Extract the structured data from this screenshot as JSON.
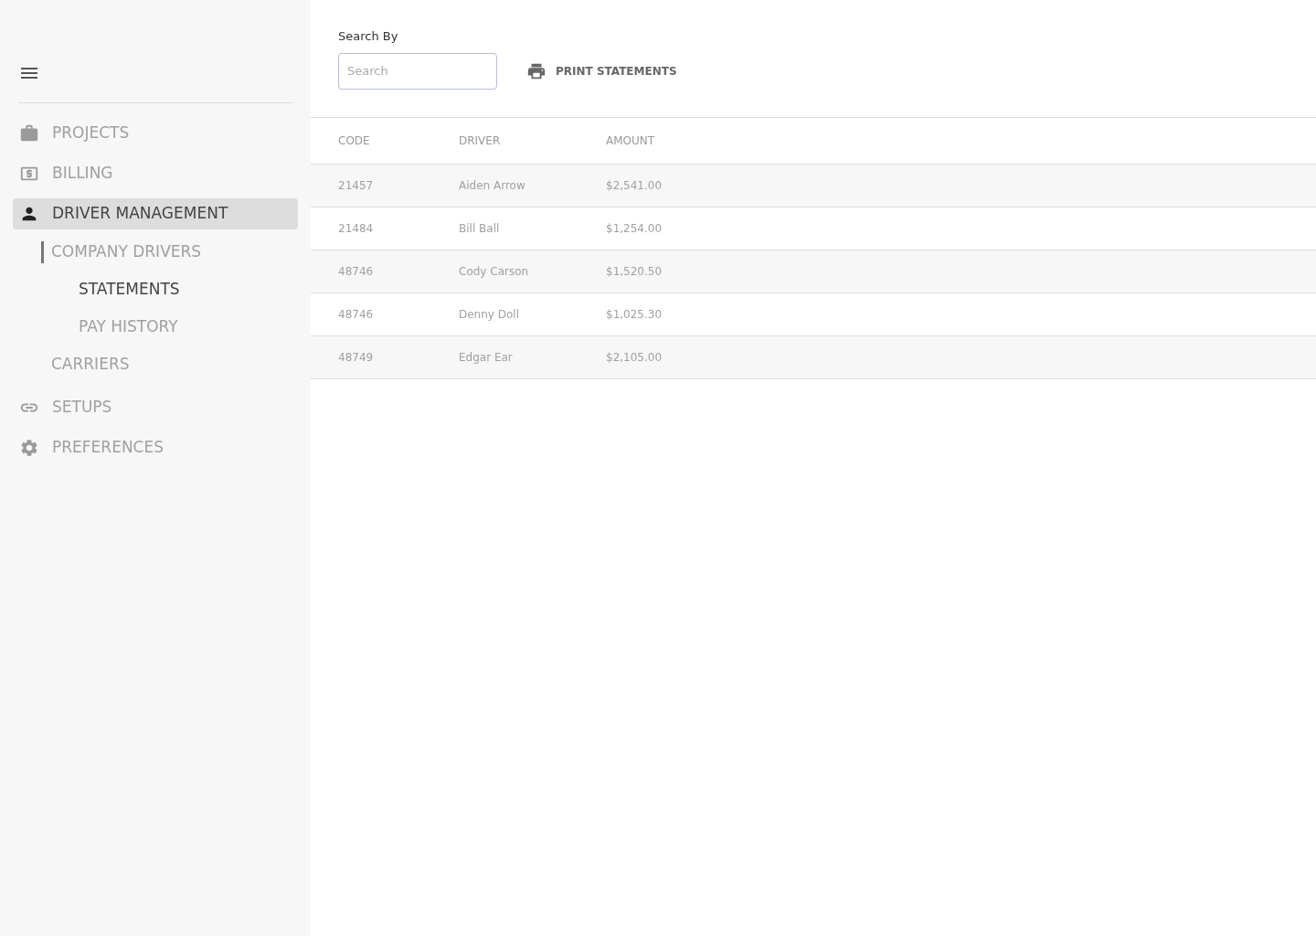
{
  "sidebar": {
    "items": [
      {
        "label": "PROJECTS",
        "selected": false
      },
      {
        "label": "BILLING",
        "selected": false
      },
      {
        "label": "DRIVER MANAGEMENT",
        "selected": true,
        "children": [
          {
            "label": "COMPANY DRIVERS",
            "selected": true,
            "children": [
              {
                "label": "STATEMENTS",
                "selected": true
              },
              {
                "label": "PAY HISTORY",
                "selected": false
              }
            ]
          },
          {
            "label": "CARRIERS",
            "selected": false
          }
        ]
      },
      {
        "label": "SETUPS",
        "selected": false
      },
      {
        "label": "PREFERENCES",
        "selected": false
      }
    ]
  },
  "search": {
    "label": "Search By",
    "placeholder": "Search"
  },
  "print_button": "PRINT STATEMENTS",
  "table": {
    "columns": [
      "CODE",
      "DRIVER",
      "AMOUNT"
    ],
    "rows": [
      [
        "21457",
        "Aiden Arrow",
        "$2,541.00"
      ],
      [
        "21484",
        "Bill Ball",
        "$1,254.00"
      ],
      [
        "48746",
        "Cody Carson",
        "$1,520.50"
      ],
      [
        "48746",
        "Denny Doll",
        "$1,025.30"
      ],
      [
        "48749",
        "Edgar Ear",
        "$2,105.00"
      ]
    ]
  }
}
